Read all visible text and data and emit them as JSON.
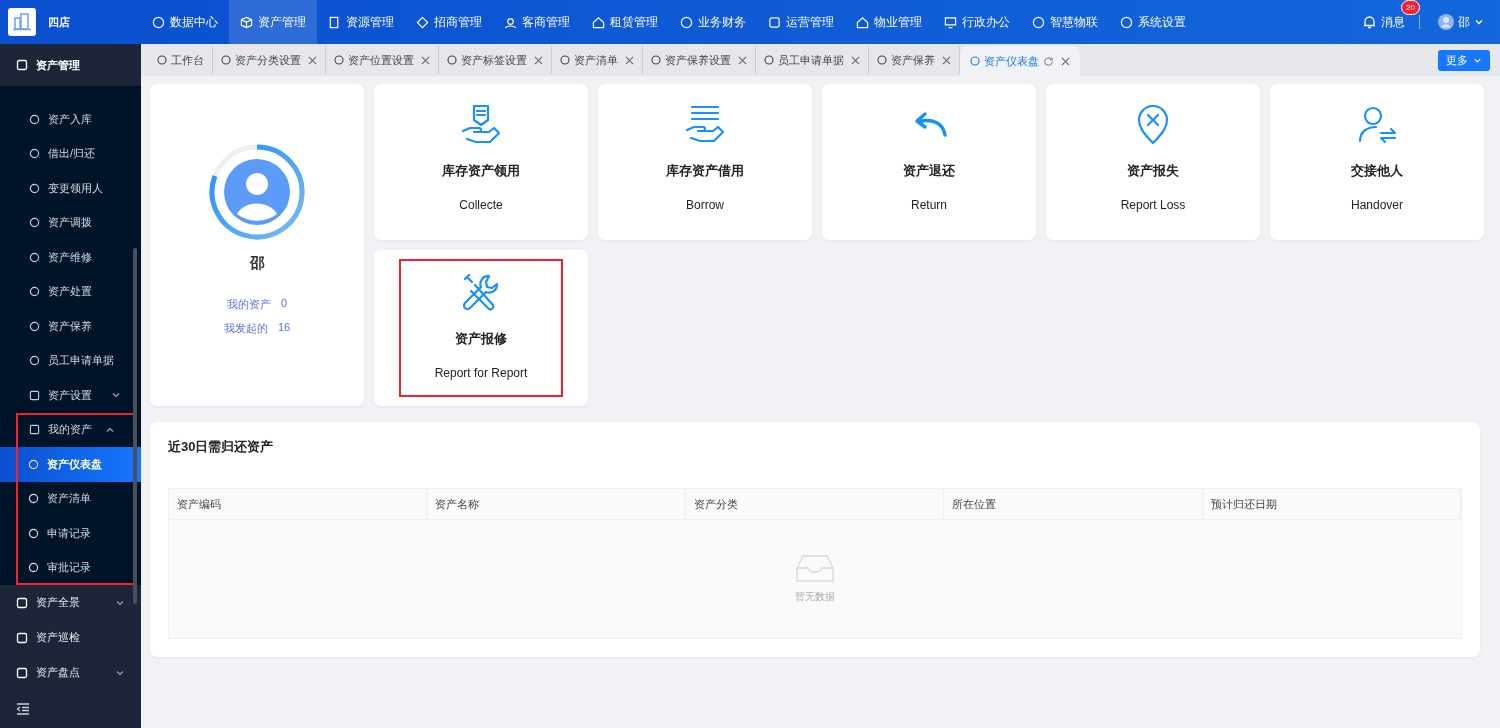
{
  "topbar": {
    "brand": "四店",
    "nav": [
      {
        "label": "数据中心",
        "selected": false
      },
      {
        "label": "资产管理",
        "selected": true
      },
      {
        "label": "资源管理",
        "selected": false
      },
      {
        "label": "招商管理",
        "selected": false
      },
      {
        "label": "客商管理",
        "selected": false
      },
      {
        "label": "租赁管理",
        "selected": false
      },
      {
        "label": "业务财务",
        "selected": false
      },
      {
        "label": "运营管理",
        "selected": false
      },
      {
        "label": "物业管理",
        "selected": false
      },
      {
        "label": "行政办公",
        "selected": false
      },
      {
        "label": "智慧物联",
        "selected": false
      },
      {
        "label": "系统设置",
        "selected": false
      }
    ],
    "messages": {
      "label": "消息",
      "badge": "20"
    },
    "user": "邵"
  },
  "sidebar": {
    "sections": [
      {
        "label": "资产管理",
        "kind": "submenu",
        "expanded": true,
        "children": [
          {
            "label": "资产入库",
            "kind": "item",
            "selected": false
          },
          {
            "label": "借出/归还",
            "kind": "item",
            "selected": false
          },
          {
            "label": "变更领用人",
            "kind": "item",
            "selected": false
          },
          {
            "label": "资产调拨",
            "kind": "item",
            "selected": false
          },
          {
            "label": "资产维修",
            "kind": "item",
            "selected": false
          },
          {
            "label": "资产处置",
            "kind": "item",
            "selected": false
          },
          {
            "label": "资产保养",
            "kind": "item",
            "selected": false
          },
          {
            "label": "员工申请单据",
            "kind": "item",
            "selected": false
          },
          {
            "label": "资产设置",
            "kind": "submenu",
            "expanded": false,
            "highlighted": false
          },
          {
            "label": "我的资产",
            "kind": "submenu",
            "expanded": true,
            "highlighted": true,
            "children": [
              {
                "label": "资产仪表盘",
                "selected": true
              },
              {
                "label": "资产清单",
                "selected": false
              },
              {
                "label": "申请记录",
                "selected": false
              },
              {
                "label": "审批记录",
                "selected": false
              }
            ]
          }
        ]
      },
      {
        "label": "资产全景",
        "kind": "submenu",
        "expanded": false
      },
      {
        "label": "资产巡检",
        "kind": "item"
      },
      {
        "label": "资产盘点",
        "kind": "submenu",
        "expanded": false
      }
    ]
  },
  "tabs": [
    {
      "label": "工作台",
      "selected": false,
      "closable": false
    },
    {
      "label": "资产分类设置",
      "selected": false,
      "closable": true
    },
    {
      "label": "资产位置设置",
      "selected": false,
      "closable": true
    },
    {
      "label": "资产标签设置",
      "selected": false,
      "closable": true
    },
    {
      "label": "资产清单",
      "selected": false,
      "closable": true
    },
    {
      "label": "资产保养设置",
      "selected": false,
      "closable": true
    },
    {
      "label": "员工申请单据",
      "selected": false,
      "closable": true
    },
    {
      "label": "资产保养",
      "selected": false,
      "closable": true
    },
    {
      "label": "资产仪表盘",
      "selected": true,
      "closable": true
    }
  ],
  "more_button": "更多",
  "profile": {
    "name": "邵",
    "stats": [
      {
        "label": "我的资产",
        "value": "0"
      },
      {
        "label": "我发起的",
        "value": "16"
      }
    ]
  },
  "actions": [
    {
      "title": "库存资产领用",
      "subtitle": "Collecte",
      "highlighted": false
    },
    {
      "title": "库存资产借用",
      "subtitle": "Borrow",
      "highlighted": false
    },
    {
      "title": "资产退还",
      "subtitle": "Return",
      "highlighted": false
    },
    {
      "title": "资产报失",
      "subtitle": "Report Loss",
      "highlighted": false
    },
    {
      "title": "交接他人",
      "subtitle": "Handover",
      "highlighted": false
    },
    {
      "title": "资产报修",
      "subtitle": "Report for Report",
      "highlighted": true
    }
  ],
  "returns": {
    "title": "近30日需归还资产",
    "columns": [
      "资产编码",
      "资产名称",
      "资产分类",
      "所在位置",
      "预计归还日期"
    ],
    "empty_text": "暂无数据"
  }
}
